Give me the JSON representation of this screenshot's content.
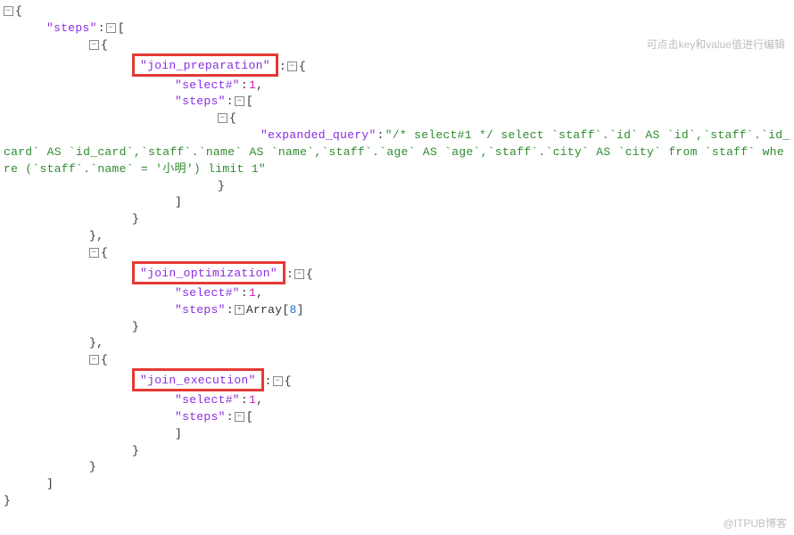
{
  "hint_text": "可点击key和value值进行编辑",
  "watermark": "@ITPUB博客",
  "toggles": {
    "minus": "−",
    "plus": "+"
  },
  "keys": {
    "steps": "\"steps\"",
    "join_preparation": "\"join_preparation\"",
    "select_num": "\"select#\"",
    "expanded_query": "\"expanded_query\"",
    "join_optimization": "\"join_optimization\"",
    "join_execution": "\"join_execution\""
  },
  "values": {
    "select_num": "1",
    "array_type": "Array",
    "array_count": "8",
    "expanded_query": "\"/* select#1 */ select `staff`.`id` AS `id`,`staff`.`id_card` AS `id_card`,`staff`.`name` AS `name`,`staff`.`age` AS `age`,`staff`.`city` AS `city` from `staff` where (`staff`.`name` = '小明') limit 1\""
  }
}
